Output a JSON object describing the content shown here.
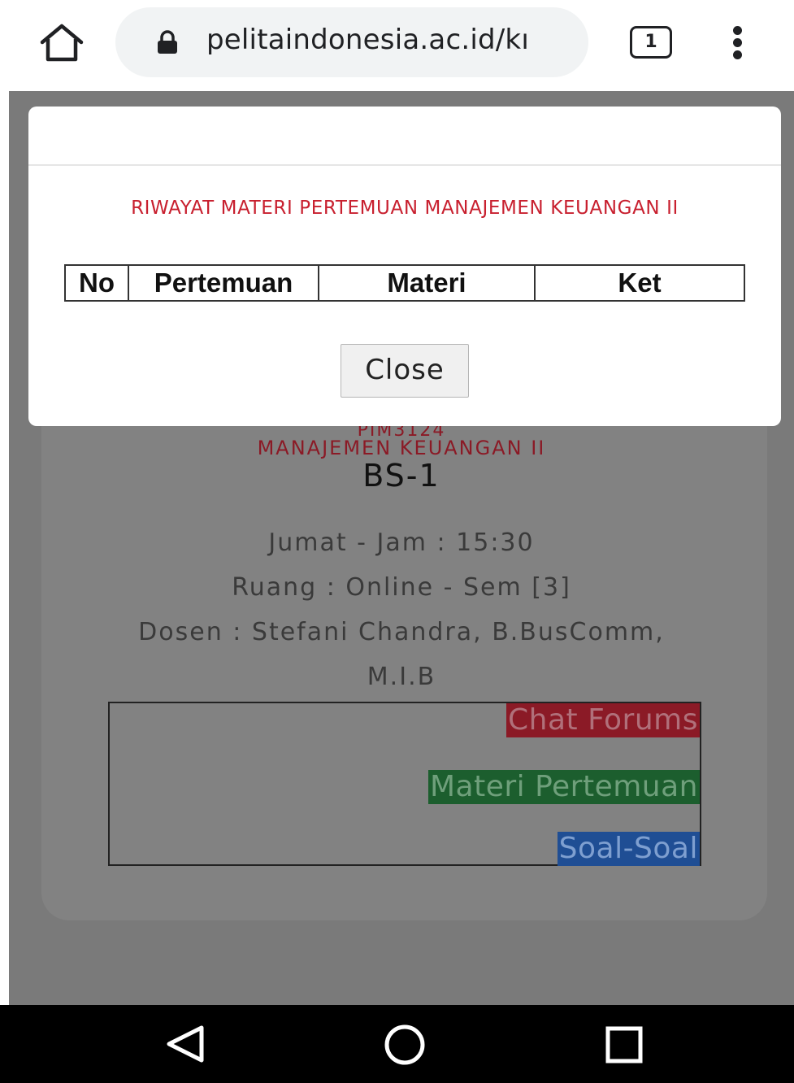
{
  "browser": {
    "url": "pelitaindonesia.ac.id/kı",
    "tab_count": "1",
    "icons": {
      "home": "home-icon",
      "lock": "lock-icon",
      "menu": "more-vert-icon"
    }
  },
  "course": {
    "code": "PIM3124",
    "name": "MANAJEMEN KEUANGAN II",
    "class": "BS-1",
    "schedule": "Jumat - Jam : 15:30",
    "room": "Ruang : Online - Sem [3]",
    "lecturer_line1": "Dosen : Stefani Chandra, B.BusComm,",
    "lecturer_line2": "M.I.B",
    "links": {
      "chat": "Chat Forums",
      "materi": "Materi Pertemuan",
      "soal": "Soal-Soal"
    }
  },
  "modal": {
    "title": "RIWAYAT MATERI PERTEMUAN MANAJEMEN KEUANGAN II",
    "columns": [
      "No",
      "Pertemuan",
      "Materi",
      "Ket"
    ],
    "close_label": "Close"
  },
  "colors": {
    "accent_red": "#c8202f",
    "chat": "#8b1a26",
    "materi": "#1c5e2e",
    "soal": "#1f4e94"
  },
  "android_nav": {
    "back": "back-icon",
    "home": "home-circle-icon",
    "recents": "recents-icon"
  }
}
